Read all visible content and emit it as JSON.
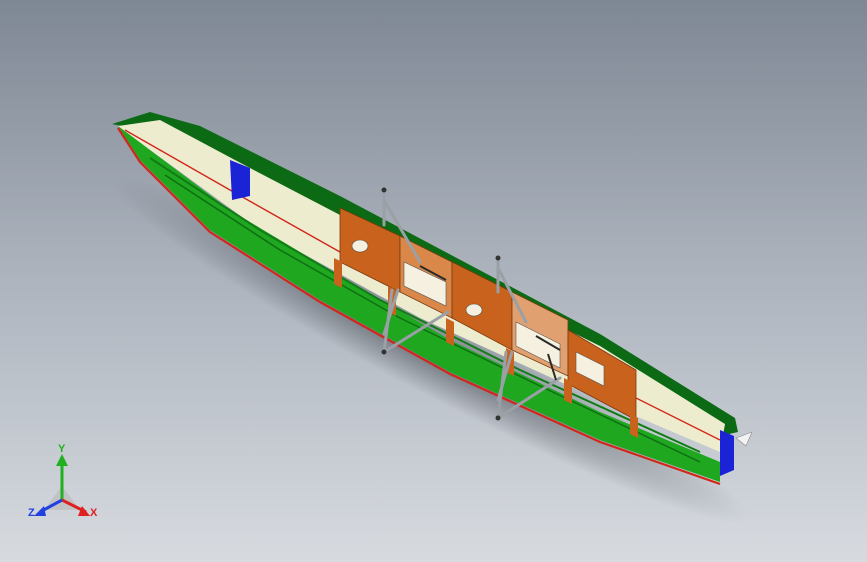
{
  "scene": {
    "background_top": "#7e8794",
    "background_bottom": "#d7dbe0"
  },
  "model": {
    "colors": {
      "hull_green": "#1fa81f",
      "hull_dark_green": "#0b6a13",
      "deck_cream": "#eeeccf",
      "panel_orange": "#c9621c",
      "bulkhead_blue": "#1b23d6",
      "trim_red": "#d2261a",
      "rigger_grey": "#9aa0a6"
    }
  },
  "triad": {
    "x_label": "X",
    "y_label": "Y",
    "z_label": "Z",
    "x_color": "#e02020",
    "y_color": "#20b020",
    "z_color": "#2040e0"
  }
}
